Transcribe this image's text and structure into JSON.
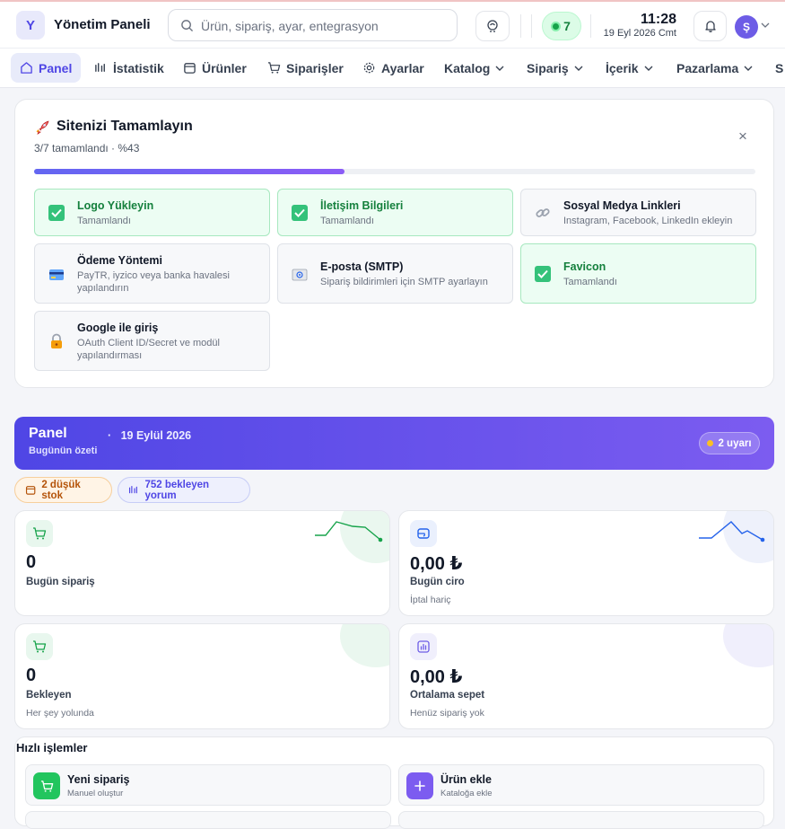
{
  "header": {
    "logo_letter": "Y",
    "title": "Yönetim Paneli",
    "search_placeholder": "Ürün, sipariş, ayar, entegrasyon ara",
    "online_count": "7",
    "time": "11:28",
    "date": "19 Eyl 2026 Cmt",
    "avatar_letter": "Ş"
  },
  "nav": {
    "items": [
      {
        "label": "Panel",
        "icon": "home-icon",
        "active": true
      },
      {
        "label": "İstatistik",
        "icon": "stats-icon"
      },
      {
        "label": "Ürünler",
        "icon": "box-icon"
      },
      {
        "label": "Siparişler",
        "icon": "cart-icon"
      },
      {
        "label": "Ayarlar",
        "icon": "gear-icon"
      },
      {
        "label": "Katalog",
        "dropdown": true
      },
      {
        "label": "Sipariş",
        "dropdown": true
      },
      {
        "label": "İçerik",
        "dropdown": true
      },
      {
        "label": "Pazarlama",
        "dropdown": true
      },
      {
        "label": "S"
      }
    ]
  },
  "setup": {
    "title": "Sitenizi Tamamlayın",
    "subtitle": "3/7 tamamlandı · %43",
    "progress": 0.43,
    "tasks": [
      {
        "title": "Logo Yükleyin",
        "desc": "Tamamlandı",
        "done": true
      },
      {
        "title": "İletişim Bilgileri",
        "desc": "Tamamlandı",
        "done": true
      },
      {
        "title": "Sosyal Medya Linkleri",
        "desc": "Instagram, Facebook, LinkedIn ekleyin",
        "done": false,
        "icon": "link-icon"
      },
      {
        "title": "Ödeme Yöntemi",
        "desc": "PayTR, iyzico veya banka havalesi yapılandırın",
        "done": false,
        "icon": "credit-card-icon"
      },
      {
        "title": "E-posta (SMTP)",
        "desc": "Sipariş bildirimleri için SMTP ayarlayın",
        "done": false,
        "icon": "email-icon"
      },
      {
        "title": "Favicon",
        "desc": "Tamamlandı",
        "done": true
      },
      {
        "title": "Google ile giriş",
        "desc": "OAuth Client ID/Secret ve modül yapılandırması",
        "done": false,
        "icon": "lock-icon"
      }
    ]
  },
  "banner": {
    "title": "Panel",
    "subtitle": "Bugünün özeti",
    "date": "19 Eylül 2026",
    "warnings": "2 uyarı"
  },
  "chips": {
    "low_stock": "2 düşük stok",
    "pending_reviews": "752 bekleyen yorum"
  },
  "kpis": {
    "orders": {
      "value": "0",
      "label": "Bugün sipariş"
    },
    "revenue": {
      "value": "0,00 ₺",
      "label": "Bugün ciro",
      "note": "İptal hariç"
    },
    "pending": {
      "value": "0",
      "label": "Bekleyen",
      "note": "Her şey yolunda"
    },
    "basket": {
      "value": "0,00 ₺",
      "label": "Ortalama sepet",
      "note": "Henüz sipariş yok"
    }
  },
  "quick": {
    "title": "Hızlı işlemler",
    "actions": [
      {
        "title": "Yeni sipariş",
        "sub": "Manuel oluştur"
      },
      {
        "title": "Ürün ekle",
        "sub": "Kataloğa ekle"
      }
    ]
  },
  "colors": {
    "accent": "#4f46e5",
    "success": "#16a34a",
    "warning": "#b45309"
  }
}
